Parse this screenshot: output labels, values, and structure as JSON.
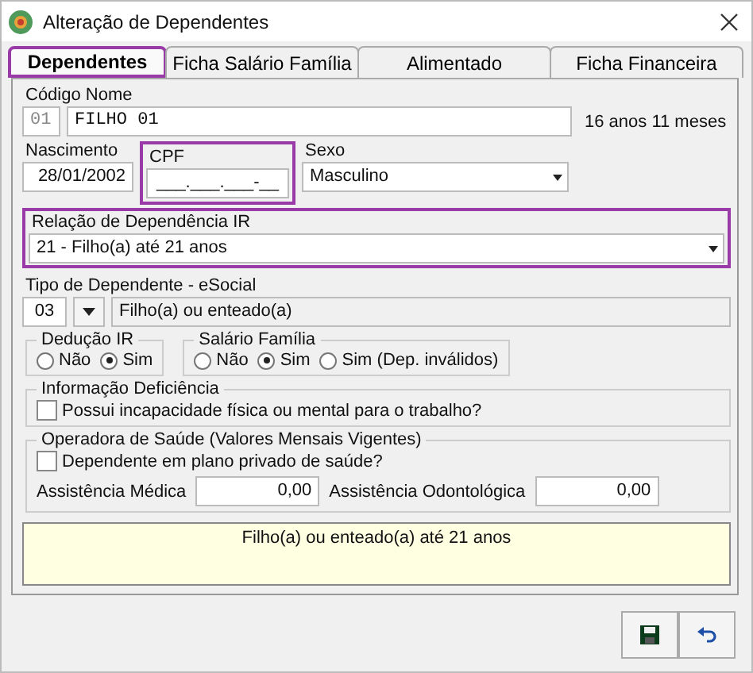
{
  "window": {
    "title": "Alteração de Dependentes"
  },
  "tabs": [
    {
      "label": "Dependentes",
      "selected": true,
      "highlighted": true
    },
    {
      "label": "Ficha Salário Família",
      "selected": false,
      "highlighted": false
    },
    {
      "label": "Alimentado",
      "selected": false,
      "highlighted": false
    },
    {
      "label": "Ficha Financeira",
      "selected": false,
      "highlighted": false
    }
  ],
  "codigo_nome": {
    "label": "Código Nome",
    "code": "01",
    "name": "FILHO 01",
    "age": "16 anos 11 meses"
  },
  "nascimento": {
    "label": "Nascimento",
    "value": "28/01/2002"
  },
  "cpf": {
    "label": "CPF",
    "value": "___.___.___-__",
    "highlighted": true
  },
  "sexo": {
    "label": "Sexo",
    "value": "Masculino"
  },
  "relacao": {
    "label": "Relação de Dependência IR",
    "value": "21 - Filho(a) até 21 anos",
    "highlighted": true
  },
  "tipo_dependente": {
    "label": "Tipo de Dependente - eSocial",
    "code": "03",
    "description": "Filho(a) ou enteado(a)"
  },
  "deducao_ir": {
    "title": "Dedução IR",
    "options": [
      {
        "label": "Não",
        "selected": false
      },
      {
        "label": "Sim",
        "selected": true
      }
    ]
  },
  "salario_familia": {
    "title": "Salário Família",
    "options": [
      {
        "label": "Não",
        "selected": false
      },
      {
        "label": "Sim",
        "selected": true
      },
      {
        "label": "Sim (Dep. inválidos)",
        "selected": false
      }
    ]
  },
  "deficiencia": {
    "title": "Informação Deficiência",
    "checkbox": {
      "label": "Possui incapacidade física ou mental para o trabalho?",
      "checked": false
    }
  },
  "saude": {
    "title": "Operadora de Saúde (Valores Mensais Vigentes)",
    "checkbox": {
      "label": "Dependente em plano privado de saúde?",
      "checked": false
    },
    "medica": {
      "label": "Assistência Médica",
      "value": "0,00"
    },
    "odonto": {
      "label": "Assistência Odontológica",
      "value": "0,00"
    }
  },
  "info_box": "Filho(a) ou enteado(a) até 21 anos"
}
